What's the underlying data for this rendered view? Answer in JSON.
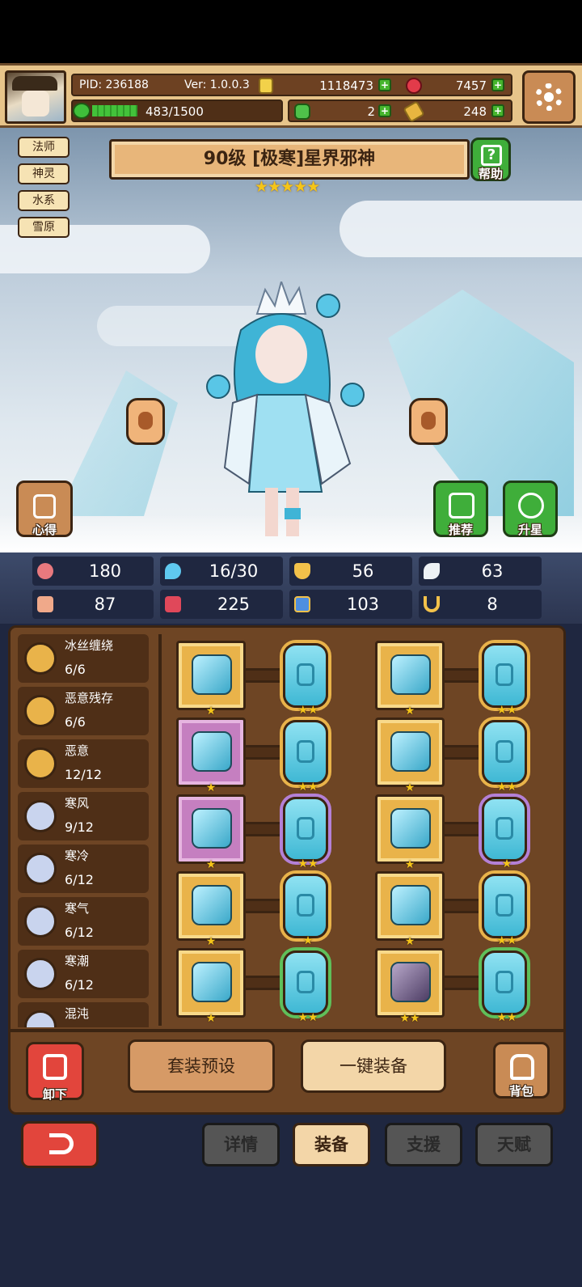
{
  "player": {
    "pid": "PID: 236188",
    "version": "Ver: 1.0.0.3",
    "energy": "483/1500"
  },
  "currency": {
    "gold": "1118473",
    "gems": "7457",
    "clover": "2",
    "scroll": "248"
  },
  "tags": [
    "法师",
    "神灵",
    "水系",
    "雪原"
  ],
  "hero": {
    "title": "90级 [极寒]星界邪神",
    "stars": "★★★★★"
  },
  "buttons": {
    "help": "帮助",
    "insight": "心得",
    "recommend": "推荐",
    "star_up": "升星",
    "unequip": "卸下",
    "bag": "背包",
    "set_preset": "套装预设",
    "one_key_equip": "一键装备"
  },
  "stats": [
    {
      "icon": "heart-icon",
      "value": "180"
    },
    {
      "icon": "water-drop-icon",
      "value": "16/30"
    },
    {
      "icon": "shield-icon",
      "value": "56"
    },
    {
      "icon": "wing-icon",
      "value": "63"
    },
    {
      "icon": "fist-icon",
      "value": "87"
    },
    {
      "icon": "book-icon",
      "value": "225"
    },
    {
      "icon": "stairs-icon",
      "value": "103"
    },
    {
      "icon": "horseshoe-icon",
      "value": "8"
    }
  ],
  "sets": [
    {
      "name": "冰丝缠绕",
      "count": "6/6"
    },
    {
      "name": "恶意残存",
      "count": "6/6"
    },
    {
      "name": "恶意",
      "count": "12/12"
    },
    {
      "name": "寒风",
      "count": "9/12"
    },
    {
      "name": "寒冷",
      "count": "6/12"
    },
    {
      "name": "寒气",
      "count": "6/12"
    },
    {
      "name": "寒潮",
      "count": "6/12"
    },
    {
      "name": "混沌",
      "count": ""
    }
  ],
  "equipment": [
    {
      "item_stars": "★",
      "gem_stars": "★★"
    },
    {
      "item_stars": "★",
      "gem_stars": "★★"
    },
    {
      "item_stars": "★",
      "gem_stars": "★★"
    },
    {
      "item_stars": "★",
      "gem_stars": "★★"
    },
    {
      "item_stars": "★",
      "gem_stars": "★★"
    },
    {
      "item_stars": "★",
      "gem_stars": "★"
    },
    {
      "item_stars": "★",
      "gem_stars": "★"
    },
    {
      "item_stars": "★",
      "gem_stars": "★★"
    },
    {
      "item_stars": "★",
      "gem_stars": "★★"
    },
    {
      "item_stars": "★★",
      "gem_stars": "★★"
    }
  ],
  "tabs": {
    "details": "详情",
    "equip": "装备",
    "support": "支援",
    "talent": "天赋"
  },
  "colors": {
    "gold_frame": "#e9b34a",
    "purple_frame": "#c57fc0",
    "green_button": "#3fae3a",
    "red_button": "#e2453c"
  }
}
